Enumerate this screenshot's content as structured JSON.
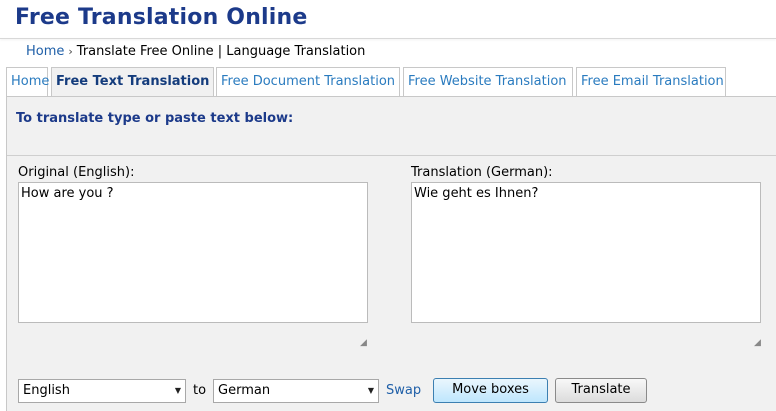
{
  "header": {
    "title": "Free Translation Online"
  },
  "breadcrumb": {
    "home": "Home",
    "separator": "›",
    "current": "Translate Free Online | Language Translation"
  },
  "tabs": [
    {
      "label": "Home"
    },
    {
      "label": "Free Text Translation"
    },
    {
      "label": "Free Document Translation"
    },
    {
      "label": "Free Website Translation"
    },
    {
      "label": "Free Email Translation"
    }
  ],
  "panel": {
    "heading": "To translate type or paste text below:",
    "original_label": "Original (English):",
    "original_text": "How are you ?",
    "translation_label": "Translation (German):",
    "translation_text": "Wie geht es Ihnen?"
  },
  "controls": {
    "source_language": "English",
    "to_label": "to",
    "target_language": "German",
    "swap_label": "Swap",
    "move_boxes_label": "Move boxes",
    "translate_label": "Translate"
  },
  "colors": {
    "title": "#1c3a8a",
    "link": "#1f5fa8",
    "tab_text": "#2a7bbf",
    "panel_bg": "#f1f1f1"
  }
}
